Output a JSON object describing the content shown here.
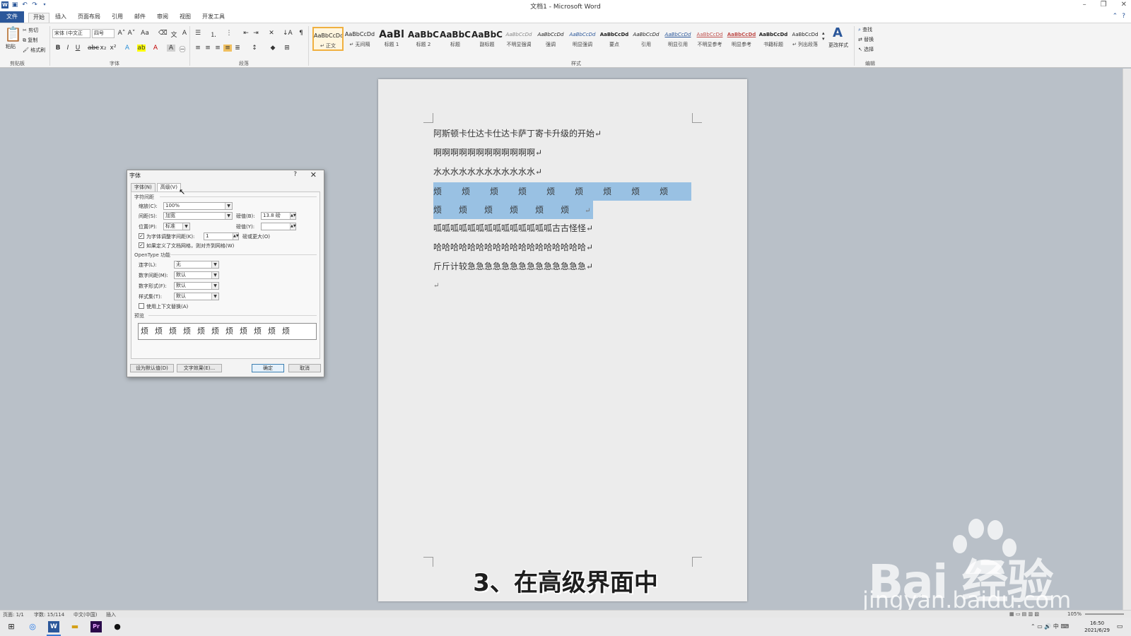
{
  "window": {
    "title": "文档1 - Microsoft Word"
  },
  "tabs": {
    "file": "文件",
    "items": [
      "开始",
      "插入",
      "页面布局",
      "引用",
      "邮件",
      "审阅",
      "视图",
      "开发工具"
    ]
  },
  "ribbon": {
    "clipboard": {
      "paste": "粘贴",
      "cut": "剪切",
      "copy": "复制",
      "format_painter": "格式刷",
      "label": "剪贴板"
    },
    "font": {
      "font_name": "宋体 (中文正",
      "font_size": "四号",
      "label": "字体"
    },
    "paragraph": {
      "label": "段落"
    },
    "styles": {
      "label": "样式",
      "tiles": [
        {
          "preview": "AaBbCcDd",
          "name": "↵ 正文"
        },
        {
          "preview": "AaBbCcDd",
          "name": "↵ 无间隔"
        },
        {
          "preview": "AaBl",
          "name": "标题 1"
        },
        {
          "preview": "AaBbC",
          "name": "标题 2"
        },
        {
          "preview": "AaBbC",
          "name": "标题"
        },
        {
          "preview": "AaBbC",
          "name": "副标题"
        },
        {
          "preview": "AaBbCcDd",
          "name": "不明显强调"
        },
        {
          "preview": "AaBbCcDd",
          "name": "强调"
        },
        {
          "preview": "AaBbCcDd",
          "name": "明显强调"
        },
        {
          "preview": "AaBbCcDd",
          "name": "要点"
        },
        {
          "preview": "AaBbCcDd",
          "name": "引用"
        },
        {
          "preview": "AaBbCcDd",
          "name": "明显引用"
        },
        {
          "preview": "AaBbCcDd",
          "name": "不明显参考"
        },
        {
          "preview": "AaBbCcDd",
          "name": "明显参考"
        },
        {
          "preview": "AaBbCcDd",
          "name": "书籍标题"
        },
        {
          "preview": "AaBbCcDd",
          "name": "↵ 列出段落"
        }
      ],
      "change_styles": "更改样式"
    },
    "editing": {
      "find": "查找",
      "replace": "替换",
      "select": "选择",
      "label": "编辑"
    }
  },
  "document": {
    "lines": [
      "阿斯顿卡仕达卡仕达卡萨丁寄卡升级的开始↵",
      "啊啊啊啊啊啊啊啊啊啊啊啊↵",
      "水水水水水水水水水水水水↵"
    ],
    "selected_row1": [
      "烦",
      "烦",
      "烦",
      "烦",
      "烦",
      "烦",
      "烦",
      "烦",
      "烦"
    ],
    "selected_row2": [
      "烦",
      "烦",
      "烦",
      "烦",
      "烦",
      "烦"
    ],
    "selected_row2_end": "↵",
    "lines_after": [
      "呱呱呱呱呱呱呱呱呱呱呱呱呱呱古古怪怪↵",
      "哈哈哈哈哈哈哈哈哈哈哈哈哈哈哈哈哈哈↵",
      "斤斤计较急急急急急急急急急急急急急急↵",
      "↵"
    ]
  },
  "caption": "3、在高级界面中",
  "watermark": {
    "logo": "Bai  经验",
    "url": "jingyan.baidu.com"
  },
  "dialog": {
    "title": "字体",
    "help": "?",
    "close": "✕",
    "tabs": [
      "字体(N)",
      "高级(V)"
    ],
    "section_spacing": "字符间距",
    "scale_label": "缩放(C):",
    "scale_value": "100%",
    "spacing_label": "间距(S):",
    "spacing_value": "加宽",
    "spacing_by_label": "磅值(B):",
    "spacing_by_value": "13.8 磅",
    "position_label": "位置(P):",
    "position_value": "标准",
    "position_by_label": "磅值(Y):",
    "position_by_value": "",
    "kerning_label": "为字体调整字间距(K):",
    "kerning_value": "1",
    "kerning_suffix": "磅或更大(O)",
    "grid_label": "如果定义了文档网格，则对齐到网格(W)",
    "section_opentype": "OpenType 功能",
    "ligatures_label": "连字(L):",
    "ligatures_value": "无",
    "num_spacing_label": "数字间距(M):",
    "num_spacing_value": "默认",
    "num_forms_label": "数字形式(F):",
    "num_forms_value": "默认",
    "style_sets_label": "样式集(T):",
    "style_sets_value": "默认",
    "contextual_label": "使用上下文替换(A)",
    "section_preview": "预览",
    "preview_text": "烦烦烦烦烦烦烦烦烦烦烦",
    "btn_default": "设为默认值(D)",
    "btn_effects": "文字效果(E)...",
    "btn_ok": "确定",
    "btn_cancel": "取消"
  },
  "statusbar": {
    "page": "页面: 1/1",
    "words": "字数: 15/114",
    "lang": "中文(中国)",
    "mode": "插入",
    "zoom": "105%"
  },
  "taskbar": {
    "time": "16:50",
    "date": "2021/6/29",
    "ime": "中"
  }
}
